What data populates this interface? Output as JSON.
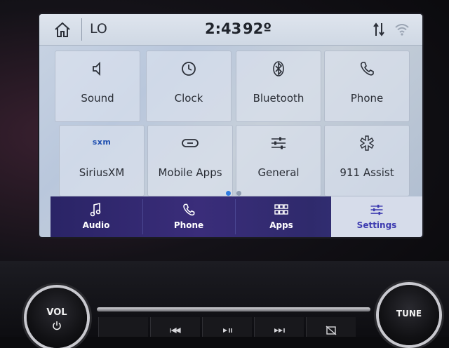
{
  "status_bar": {
    "climate_setting": "LO",
    "time": "2:43",
    "temperature": "92º"
  },
  "tiles": [
    {
      "label": "Sound",
      "icon": "speaker-icon"
    },
    {
      "label": "Clock",
      "icon": "clock-icon"
    },
    {
      "label": "Bluetooth",
      "icon": "bluetooth-icon"
    },
    {
      "label": "Phone",
      "icon": "phone-icon"
    },
    {
      "label": "SiriusXM",
      "icon": "sxm-icon",
      "icon_text": "sxm"
    },
    {
      "label": "Mobile Apps",
      "icon": "link-icon"
    },
    {
      "label": "General",
      "icon": "sliders-icon"
    },
    {
      "label": "911 Assist",
      "icon": "emergency-icon"
    }
  ],
  "pager": {
    "current_page": 1,
    "total_pages": 2
  },
  "nav": [
    {
      "label": "Audio",
      "icon": "music-note-icon",
      "active": false
    },
    {
      "label": "Phone",
      "icon": "phone-icon",
      "active": false
    },
    {
      "label": "Apps",
      "icon": "apps-grid-icon",
      "active": false
    },
    {
      "label": "Settings",
      "icon": "sliders-icon",
      "active": true
    }
  ],
  "hardware": {
    "vol_label": "VOL",
    "tune_label": "TUNE"
  },
  "colors": {
    "nav_bg": "#2a2466",
    "nav_active_bg": "#d6dcea",
    "nav_active_text": "#3d3bb0",
    "pager_active": "#2f7be0",
    "pager_inactive": "#8e9bb0"
  }
}
